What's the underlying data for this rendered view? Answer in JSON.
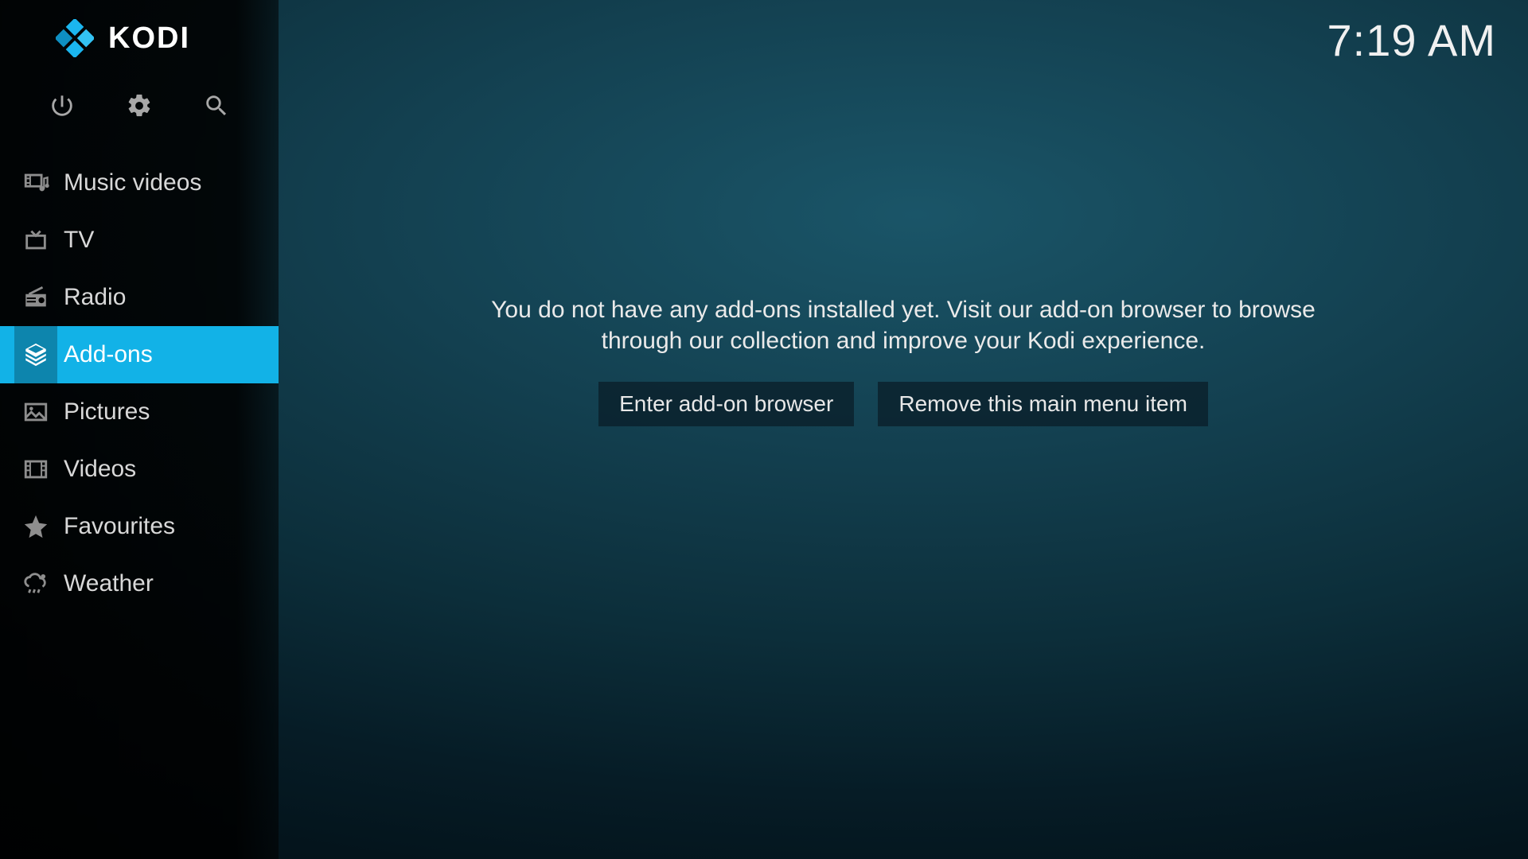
{
  "header": {
    "brand": "KODI",
    "clock": "7:19 AM"
  },
  "sidebar": {
    "items": [
      {
        "id": "music-videos",
        "label": "Music videos",
        "icon": "musicvideo",
        "active": false
      },
      {
        "id": "tv",
        "label": "TV",
        "icon": "tv",
        "active": false
      },
      {
        "id": "radio",
        "label": "Radio",
        "icon": "radio",
        "active": false
      },
      {
        "id": "addons",
        "label": "Add-ons",
        "icon": "addons",
        "active": true
      },
      {
        "id": "pictures",
        "label": "Pictures",
        "icon": "pictures",
        "active": false
      },
      {
        "id": "videos",
        "label": "Videos",
        "icon": "videos",
        "active": false
      },
      {
        "id": "favourites",
        "label": "Favourites",
        "icon": "star",
        "active": false
      },
      {
        "id": "weather",
        "label": "Weather",
        "icon": "weather",
        "active": false
      }
    ],
    "utility": {
      "power": "power-icon",
      "settings": "gear-icon",
      "search": "search-icon"
    }
  },
  "main": {
    "empty_message": "You do not have any add-ons installed yet. Visit our add-on browser to browse through our collection and improve your Kodi experience.",
    "buttons": {
      "enter_browser": "Enter add-on browser",
      "remove_item": "Remove this main menu item"
    }
  },
  "colors": {
    "accent": "#12b2e7"
  }
}
